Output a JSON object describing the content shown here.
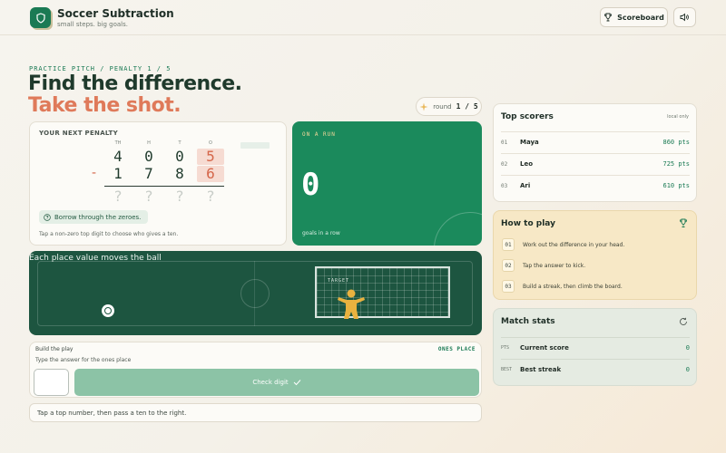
{
  "header": {
    "title": "Soccer Subtraction",
    "subtitle": "small steps. big goals.",
    "scoreboard_label": "Scoreboard"
  },
  "hero": {
    "crumb": "PRACTICE PITCH / PENALTY 1 / 5",
    "line1": "Find the difference.",
    "line2": "Take the shot.",
    "round_label": "round",
    "round_value": "1 / 5"
  },
  "penalty": {
    "label": "YOUR NEXT PENALTY",
    "columns": [
      "TH",
      "H",
      "T",
      "O"
    ],
    "top_digits": [
      "4",
      "0",
      "0",
      "5"
    ],
    "bottom_digits": [
      "1",
      "7",
      "8",
      "6"
    ],
    "operator": "-",
    "answer_digits": [
      "?",
      "?",
      "?",
      "?"
    ],
    "hint": "Borrow through the zeroes.",
    "note": "Tap a non-zero top digit to choose who gives a ten."
  },
  "streak": {
    "label": "ON A RUN",
    "value": "0",
    "caption": "goals in a row"
  },
  "pitch": {
    "title": "Each place value moves the ball",
    "goal_label": "TARGET"
  },
  "build": {
    "title": "Build the play",
    "place": "ONES PLACE",
    "instruction": "Type the answer for the ones place",
    "check_label": "Check digit"
  },
  "status": "Tap a top number, then pass a ten to the right.",
  "scorers": {
    "title": "Top scorers",
    "tag": "local only",
    "rows": [
      {
        "rank": "01",
        "name": "Maya",
        "points": "860 pts"
      },
      {
        "rank": "02",
        "name": "Leo",
        "points": "725 pts"
      },
      {
        "rank": "03",
        "name": "Ari",
        "points": "610 pts"
      }
    ]
  },
  "howto": {
    "title": "How to play",
    "steps": [
      {
        "no": "01",
        "text": "Work out the difference in your head."
      },
      {
        "no": "02",
        "text": "Tap the answer to kick."
      },
      {
        "no": "03",
        "text": "Build a streak, then climb the board."
      }
    ]
  },
  "stats": {
    "title": "Match stats",
    "rows": [
      {
        "key": "PTS",
        "label": "Current score",
        "value": "0"
      },
      {
        "key": "BEST",
        "label": "Best streak",
        "value": "0"
      }
    ]
  },
  "colors": {
    "brand_green": "#1a7a54",
    "accent_coral": "#df7a5a",
    "streak_green": "#1b8a5c",
    "pitch_green": "#1d5540"
  }
}
